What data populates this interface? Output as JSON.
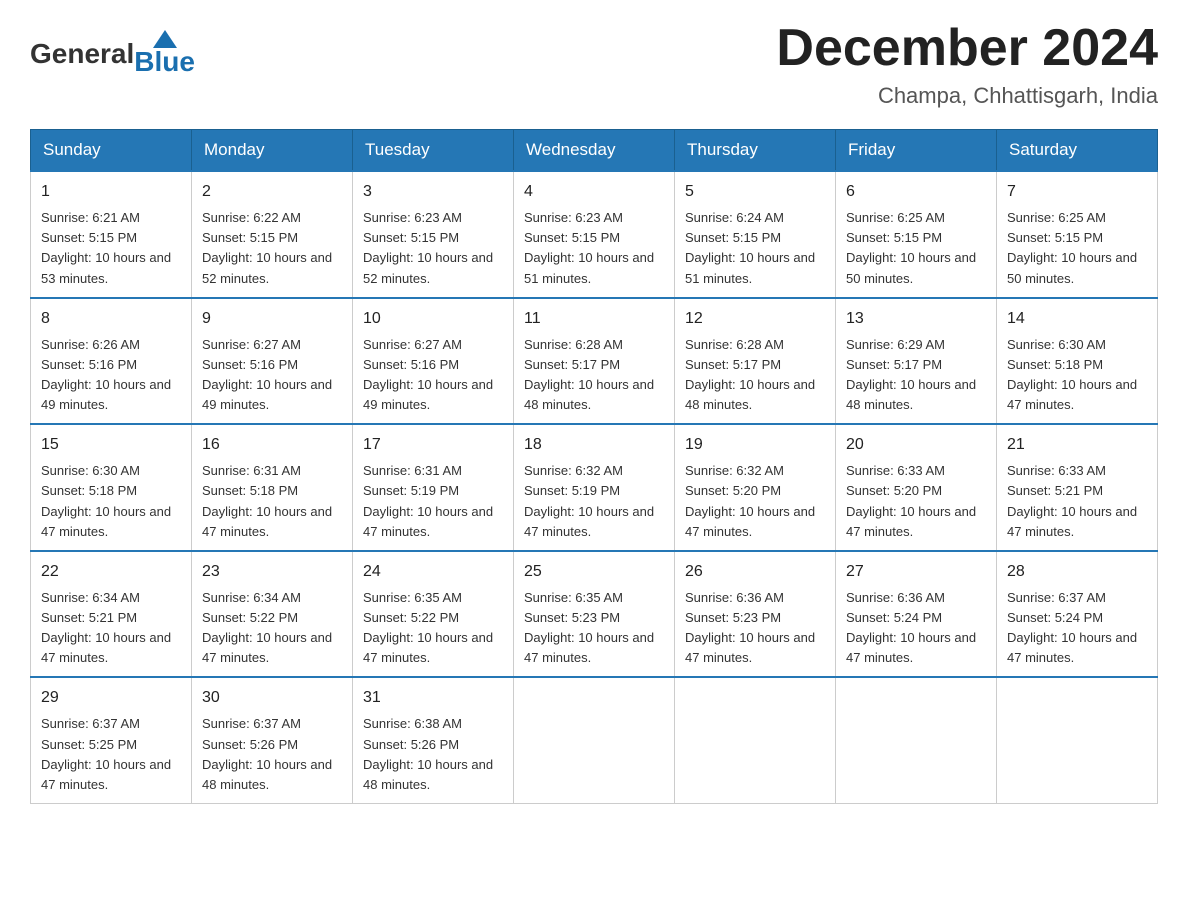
{
  "header": {
    "logo_general": "General",
    "logo_blue": "Blue",
    "month_title": "December 2024",
    "location": "Champa, Chhattisgarh, India"
  },
  "days_of_week": [
    "Sunday",
    "Monday",
    "Tuesday",
    "Wednesday",
    "Thursday",
    "Friday",
    "Saturday"
  ],
  "weeks": [
    [
      {
        "day": "1",
        "sunrise": "6:21 AM",
        "sunset": "5:15 PM",
        "daylight": "10 hours and 53 minutes."
      },
      {
        "day": "2",
        "sunrise": "6:22 AM",
        "sunset": "5:15 PM",
        "daylight": "10 hours and 52 minutes."
      },
      {
        "day": "3",
        "sunrise": "6:23 AM",
        "sunset": "5:15 PM",
        "daylight": "10 hours and 52 minutes."
      },
      {
        "day": "4",
        "sunrise": "6:23 AM",
        "sunset": "5:15 PM",
        "daylight": "10 hours and 51 minutes."
      },
      {
        "day": "5",
        "sunrise": "6:24 AM",
        "sunset": "5:15 PM",
        "daylight": "10 hours and 51 minutes."
      },
      {
        "day": "6",
        "sunrise": "6:25 AM",
        "sunset": "5:15 PM",
        "daylight": "10 hours and 50 minutes."
      },
      {
        "day": "7",
        "sunrise": "6:25 AM",
        "sunset": "5:15 PM",
        "daylight": "10 hours and 50 minutes."
      }
    ],
    [
      {
        "day": "8",
        "sunrise": "6:26 AM",
        "sunset": "5:16 PM",
        "daylight": "10 hours and 49 minutes."
      },
      {
        "day": "9",
        "sunrise": "6:27 AM",
        "sunset": "5:16 PM",
        "daylight": "10 hours and 49 minutes."
      },
      {
        "day": "10",
        "sunrise": "6:27 AM",
        "sunset": "5:16 PM",
        "daylight": "10 hours and 49 minutes."
      },
      {
        "day": "11",
        "sunrise": "6:28 AM",
        "sunset": "5:17 PM",
        "daylight": "10 hours and 48 minutes."
      },
      {
        "day": "12",
        "sunrise": "6:28 AM",
        "sunset": "5:17 PM",
        "daylight": "10 hours and 48 minutes."
      },
      {
        "day": "13",
        "sunrise": "6:29 AM",
        "sunset": "5:17 PM",
        "daylight": "10 hours and 48 minutes."
      },
      {
        "day": "14",
        "sunrise": "6:30 AM",
        "sunset": "5:18 PM",
        "daylight": "10 hours and 47 minutes."
      }
    ],
    [
      {
        "day": "15",
        "sunrise": "6:30 AM",
        "sunset": "5:18 PM",
        "daylight": "10 hours and 47 minutes."
      },
      {
        "day": "16",
        "sunrise": "6:31 AM",
        "sunset": "5:18 PM",
        "daylight": "10 hours and 47 minutes."
      },
      {
        "day": "17",
        "sunrise": "6:31 AM",
        "sunset": "5:19 PM",
        "daylight": "10 hours and 47 minutes."
      },
      {
        "day": "18",
        "sunrise": "6:32 AM",
        "sunset": "5:19 PM",
        "daylight": "10 hours and 47 minutes."
      },
      {
        "day": "19",
        "sunrise": "6:32 AM",
        "sunset": "5:20 PM",
        "daylight": "10 hours and 47 minutes."
      },
      {
        "day": "20",
        "sunrise": "6:33 AM",
        "sunset": "5:20 PM",
        "daylight": "10 hours and 47 minutes."
      },
      {
        "day": "21",
        "sunrise": "6:33 AM",
        "sunset": "5:21 PM",
        "daylight": "10 hours and 47 minutes."
      }
    ],
    [
      {
        "day": "22",
        "sunrise": "6:34 AM",
        "sunset": "5:21 PM",
        "daylight": "10 hours and 47 minutes."
      },
      {
        "day": "23",
        "sunrise": "6:34 AM",
        "sunset": "5:22 PM",
        "daylight": "10 hours and 47 minutes."
      },
      {
        "day": "24",
        "sunrise": "6:35 AM",
        "sunset": "5:22 PM",
        "daylight": "10 hours and 47 minutes."
      },
      {
        "day": "25",
        "sunrise": "6:35 AM",
        "sunset": "5:23 PM",
        "daylight": "10 hours and 47 minutes."
      },
      {
        "day": "26",
        "sunrise": "6:36 AM",
        "sunset": "5:23 PM",
        "daylight": "10 hours and 47 minutes."
      },
      {
        "day": "27",
        "sunrise": "6:36 AM",
        "sunset": "5:24 PM",
        "daylight": "10 hours and 47 minutes."
      },
      {
        "day": "28",
        "sunrise": "6:37 AM",
        "sunset": "5:24 PM",
        "daylight": "10 hours and 47 minutes."
      }
    ],
    [
      {
        "day": "29",
        "sunrise": "6:37 AM",
        "sunset": "5:25 PM",
        "daylight": "10 hours and 47 minutes."
      },
      {
        "day": "30",
        "sunrise": "6:37 AM",
        "sunset": "5:26 PM",
        "daylight": "10 hours and 48 minutes."
      },
      {
        "day": "31",
        "sunrise": "6:38 AM",
        "sunset": "5:26 PM",
        "daylight": "10 hours and 48 minutes."
      },
      null,
      null,
      null,
      null
    ]
  ]
}
